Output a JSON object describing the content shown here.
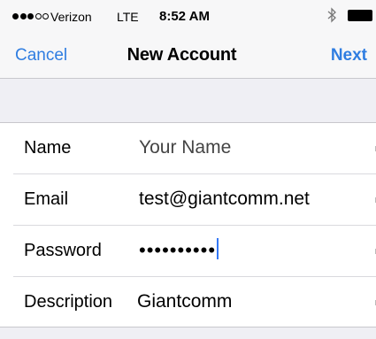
{
  "status_bar": {
    "signal_dots_filled": 3,
    "signal_dots_total": 5,
    "carrier": "Verizon",
    "network": "LTE",
    "time": "8:52 AM",
    "bluetooth_icon": "bluetooth-icon",
    "battery_icon": "battery-icon"
  },
  "nav": {
    "cancel_label": "Cancel",
    "title": "New Account",
    "next_label": "Next"
  },
  "form": {
    "rows": [
      {
        "label": "Name",
        "value": "Your Name",
        "is_placeholder": true
      },
      {
        "label": "Email",
        "value": "test@giantcomm.net"
      },
      {
        "label": "Password",
        "value": "••••••••••"
      },
      {
        "label": "Description",
        "value": "Giantcomm"
      }
    ]
  },
  "colors": {
    "accent": "#2f7de1",
    "background": "#efeff4",
    "bar": "#f7f7f8",
    "cursor": "#3478f6"
  }
}
